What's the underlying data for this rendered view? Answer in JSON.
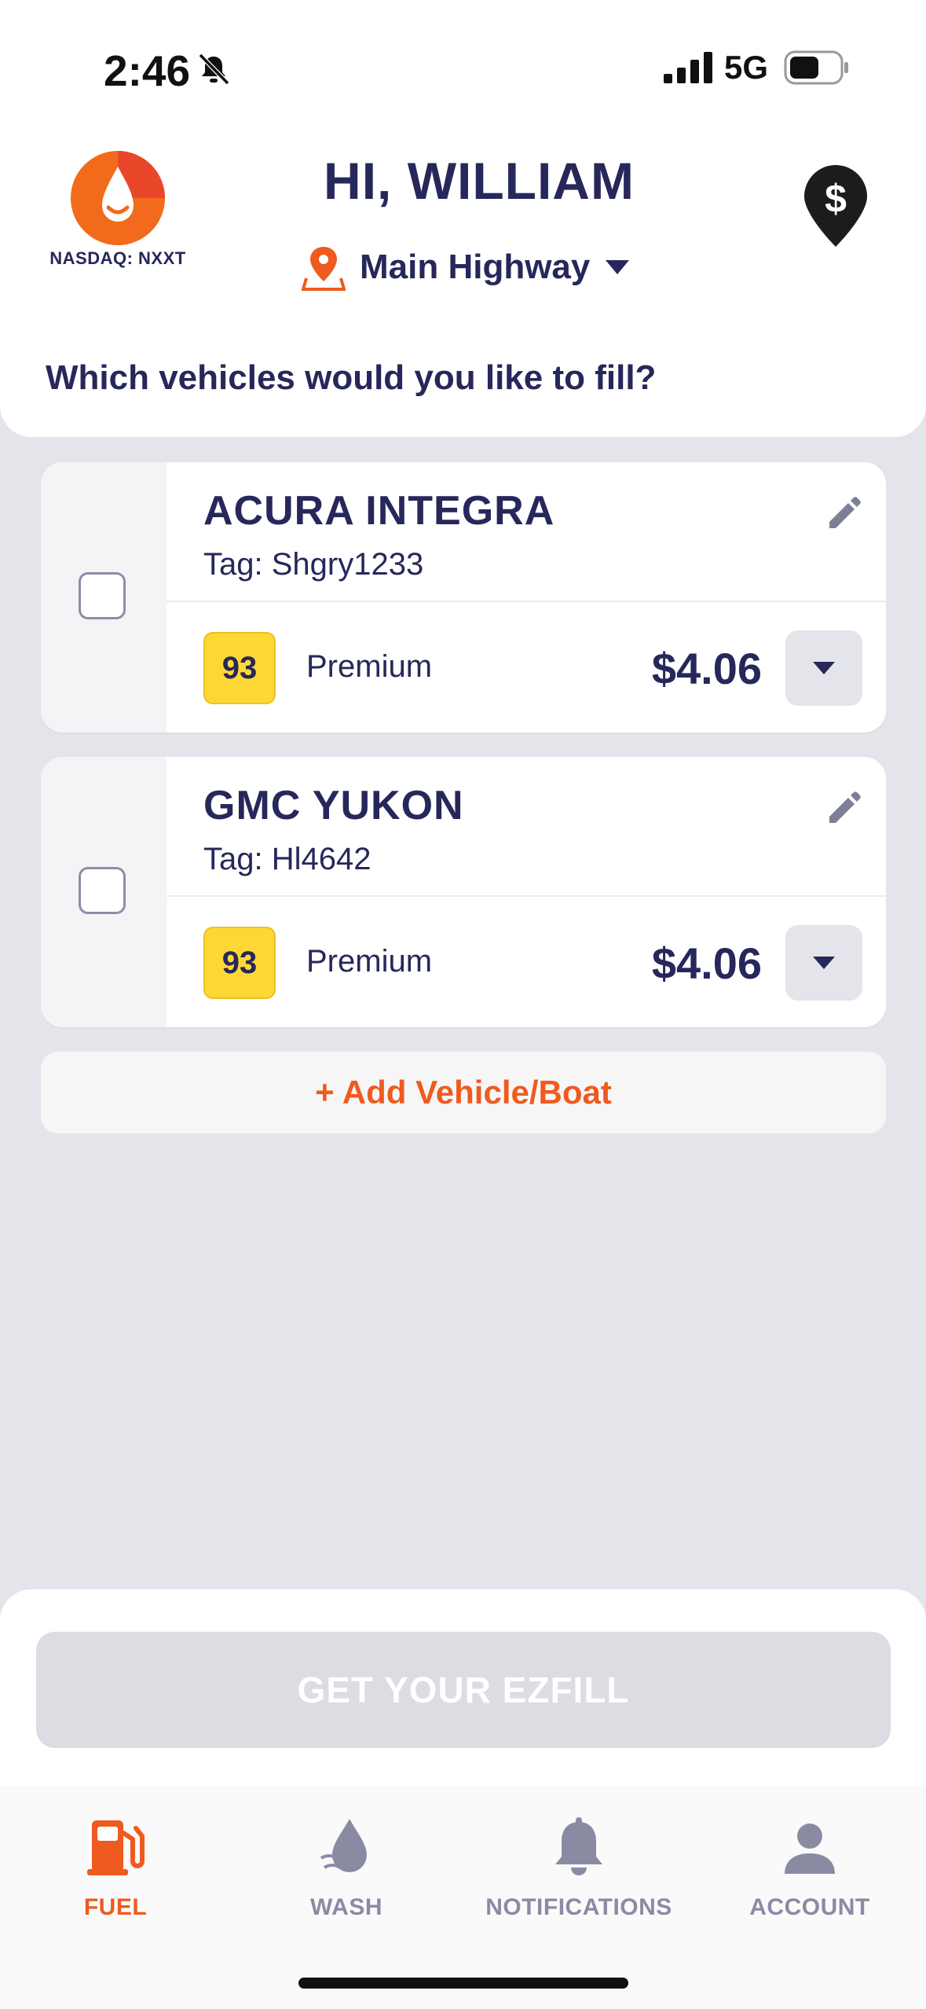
{
  "status_bar": {
    "time": "2:46",
    "network": "5G"
  },
  "header": {
    "logo_caption": "NASDAQ: NXXT",
    "greeting": "HI, WILLIAM",
    "location": "Main Highway",
    "question": "Which vehicles would you like to fill?"
  },
  "vehicles": [
    {
      "name": "ACURA INTEGRA",
      "tag": "Tag: Shgry1233",
      "grade": "93",
      "grade_name": "Premium",
      "price": "$4.06",
      "selected": false
    },
    {
      "name": "GMC YUKON",
      "tag": "Tag: Hl4642",
      "grade": "93",
      "grade_name": "Premium",
      "price": "$4.06",
      "selected": false
    }
  ],
  "add_vehicle_label": "+ Add Vehicle/Boat",
  "cta_label": "GET YOUR EZFILL",
  "tabs": [
    {
      "label": "FUEL",
      "icon": "fuel-pump-icon",
      "active": true
    },
    {
      "label": "WASH",
      "icon": "water-drop-icon",
      "active": false
    },
    {
      "label": "NOTIFICATIONS",
      "icon": "bell-icon",
      "active": false
    },
    {
      "label": "ACCOUNT",
      "icon": "user-icon",
      "active": false
    }
  ],
  "colors": {
    "brand_orange": "#ef5a1e",
    "navy": "#26275a",
    "grade_yellow": "#fdd835",
    "inactive": "#8a8ba3"
  }
}
